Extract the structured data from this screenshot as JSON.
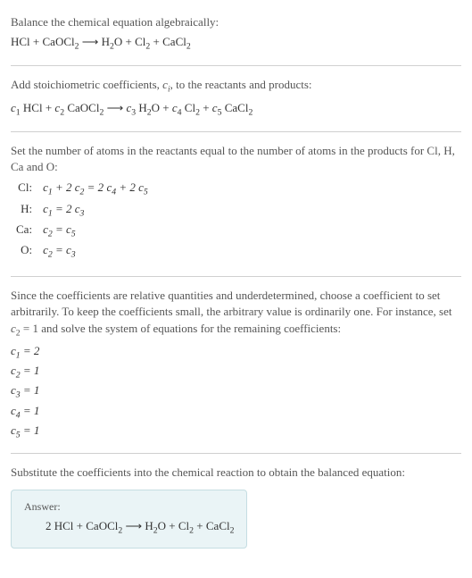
{
  "section1": {
    "intro": "Balance the chemical equation algebraically:",
    "eq_lhs_1": "HCl + CaOCl",
    "eq_lhs_2": "2",
    "arrow": " ⟶ ",
    "eq_rhs_1": "H",
    "eq_rhs_2": "2",
    "eq_rhs_3": "O + Cl",
    "eq_rhs_4": "2",
    "eq_rhs_5": " + CaCl",
    "eq_rhs_6": "2"
  },
  "section2": {
    "intro_a": "Add stoichiometric coefficients, ",
    "intro_c": "c",
    "intro_i": "i",
    "intro_b": ", to the reactants and products:",
    "c1": "c",
    "c1s": "1",
    "t1": " HCl + ",
    "c2": "c",
    "c2s": "2",
    "t2": " CaOCl",
    "t2s": "2",
    "arrow": " ⟶ ",
    "c3": "c",
    "c3s": "3",
    "t3": " H",
    "t3s": "2",
    "t4": "O + ",
    "c4": "c",
    "c4s": "4",
    "t5": " Cl",
    "t5s": "2",
    "t6": " + ",
    "c5": "c",
    "c5s": "5",
    "t7": " CaCl",
    "t7s": "2"
  },
  "section3": {
    "intro": "Set the number of atoms in the reactants equal to the number of atoms in the products for Cl, H, Ca and O:",
    "rows": [
      {
        "label": "Cl:",
        "c_a": "c",
        "s_a": "1",
        "mid1": " + 2 ",
        "c_b": "c",
        "s_b": "2",
        "eq": " = 2 ",
        "c_c": "c",
        "s_c": "4",
        "mid2": " + 2 ",
        "c_d": "c",
        "s_d": "5"
      },
      {
        "label": "H:",
        "c_a": "c",
        "s_a": "1",
        "eq": " = 2 ",
        "c_c": "c",
        "s_c": "3"
      },
      {
        "label": "Ca:",
        "c_a": "c",
        "s_a": "2",
        "eq": " = ",
        "c_c": "c",
        "s_c": "5"
      },
      {
        "label": "O:",
        "c_a": "c",
        "s_a": "2",
        "eq": " = ",
        "c_c": "c",
        "s_c": "3"
      }
    ]
  },
  "section4": {
    "intro_a": "Since the coefficients are relative quantities and underdetermined, choose a coefficient to set arbitrarily. To keep the coefficients small, the arbitrary value is ordinarily one. For instance, set ",
    "intro_c": "c",
    "intro_s": "2",
    "intro_b": " = 1 and solve the system of equations for the remaining coefficients:",
    "lines": [
      {
        "c": "c",
        "s": "1",
        "v": " = 2"
      },
      {
        "c": "c",
        "s": "2",
        "v": " = 1"
      },
      {
        "c": "c",
        "s": "3",
        "v": " = 1"
      },
      {
        "c": "c",
        "s": "4",
        "v": " = 1"
      },
      {
        "c": "c",
        "s": "5",
        "v": " = 1"
      }
    ]
  },
  "section5": {
    "intro": "Substitute the coefficients into the chemical reaction to obtain the balanced equation:",
    "answer_label": "Answer:",
    "eq_1": "2 HCl + CaOCl",
    "eq_2": "2",
    "arrow": " ⟶ ",
    "eq_3": "H",
    "eq_4": "2",
    "eq_5": "O + Cl",
    "eq_6": "2",
    "eq_7": " + CaCl",
    "eq_8": "2"
  }
}
